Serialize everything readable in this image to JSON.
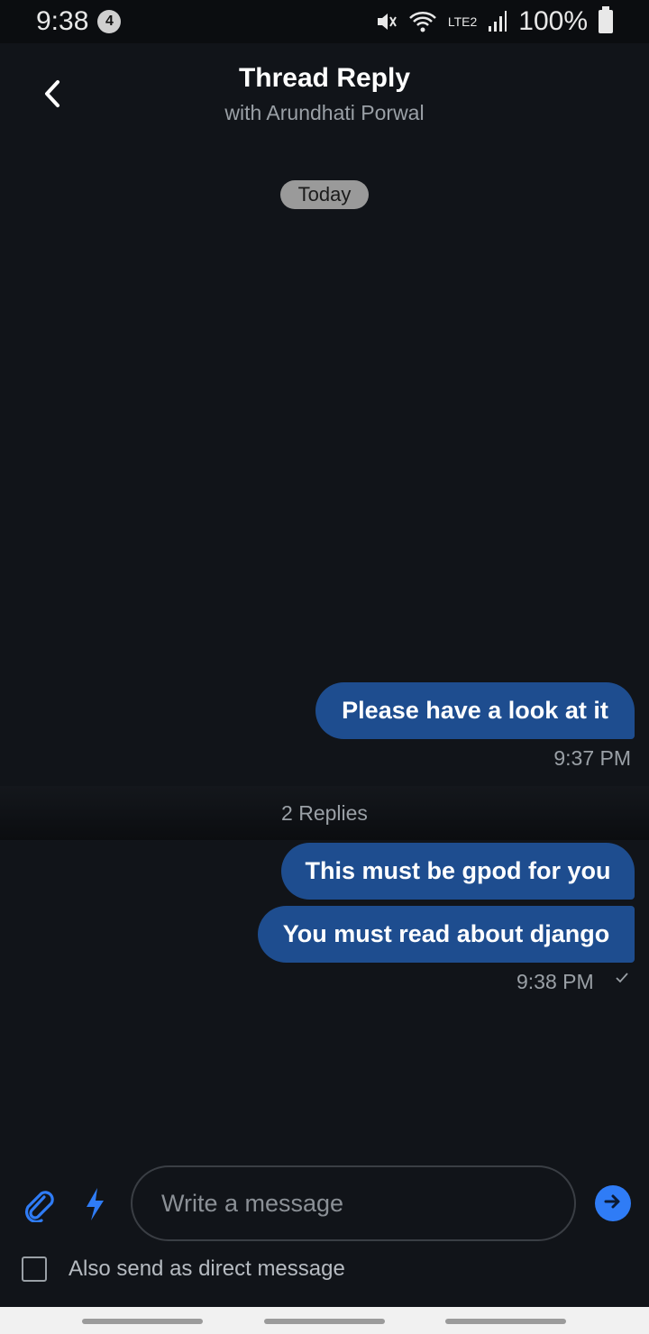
{
  "status_bar": {
    "time": "9:38",
    "notification_count": "4",
    "battery": "100%",
    "network_label": "LTE2"
  },
  "header": {
    "title": "Thread Reply",
    "subtitle": "with Arundhati Porwal"
  },
  "conversation": {
    "date_label": "Today",
    "parent_message": {
      "text": "Please have a look at it",
      "time": "9:37 PM"
    },
    "replies_label": "2 Replies",
    "replies": [
      {
        "text": "This must be gpod for you"
      },
      {
        "text": "You must read about django"
      }
    ],
    "replies_time": "9:38 PM"
  },
  "composer": {
    "placeholder": "Write a message",
    "value": "",
    "dm_option_label": "Also send as direct message"
  },
  "colors": {
    "background": "#111419",
    "bubble": "#1e4d8f",
    "accent": "#2f7cf6"
  }
}
